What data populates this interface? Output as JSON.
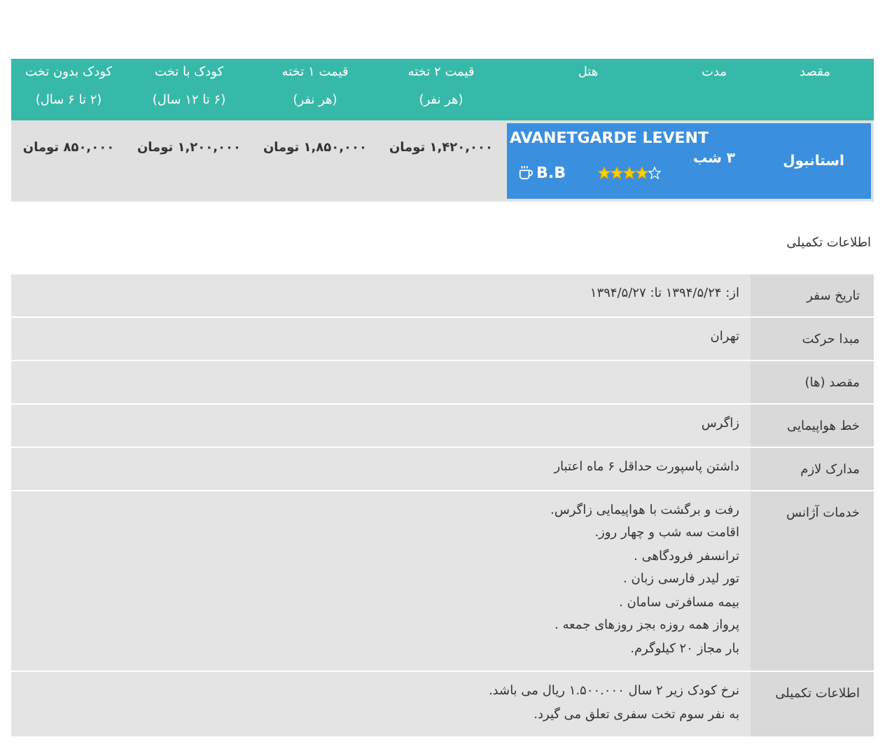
{
  "tour_table": {
    "columns": [
      {
        "label": "مقصد"
      },
      {
        "label": "مدت"
      },
      {
        "label": "هتل"
      },
      {
        "label": "قیمت ۲ تخته",
        "note": "(هر نفر)"
      },
      {
        "label": "قیمت ۱ تخته",
        "note": "(هر نفر)"
      },
      {
        "label": "کودک با تخت",
        "note": "(۶ تا ۱۲ سال)"
      },
      {
        "label": "کودک بدون تخت",
        "note": "(۲ تا ۶ سال)"
      }
    ],
    "row": {
      "destination": "استانبول",
      "duration": "۳ شب",
      "hotel": {
        "name": "AVANETGARDE LEVENT",
        "stars": 4,
        "board": "B.B"
      },
      "prices": [
        "۱,۴۲۰,۰۰۰ تومان",
        "۱,۸۵۰,۰۰۰ تومان",
        "۱,۲۰۰,۰۰۰ تومان",
        "۸۵۰,۰۰۰ تومان"
      ]
    }
  },
  "section_title": "اطلاعات تکمیلی",
  "details": [
    {
      "label": "تاریخ سفر",
      "lines": [
        "از: ۱۳۹۴/۵/۲۴ تا: ۱۳۹۴/۵/۲۷"
      ]
    },
    {
      "label": "مبدا حرکت",
      "lines": [
        "تهران"
      ]
    },
    {
      "label": "مقصد (ها)"
    },
    {
      "label": "خط هواپیمایی",
      "lines": [
        "زاگرس"
      ]
    },
    {
      "label": "مدارک لازم",
      "lines": [
        "داشتن پاسپورت حداقل ۶ ماه اعتبار"
      ]
    },
    {
      "label": "خدمات آژانس",
      "lines": [
        "رفت و برگشت با هواپیمایی زاگرس.",
        "اقامت سه شب و چهار روز.",
        "ترانسفر فرودگاهی .",
        "تور لیدر فارسی زبان .",
        "بیمه مسافرتی سامان .",
        "پرواز همه روزه بجز روزهای جمعه .",
        "بار مجاز ۲۰ کیلوگرم."
      ]
    },
    {
      "label": "اطلاعات تکمیلی",
      "lines": [
        "نرخ کودک زیر ۲ سال ۱.۵۰۰.۰۰۰ ریال می باشد.",
        "به نفر سوم تخت سفری تعلق می گیرد."
      ]
    }
  ]
}
